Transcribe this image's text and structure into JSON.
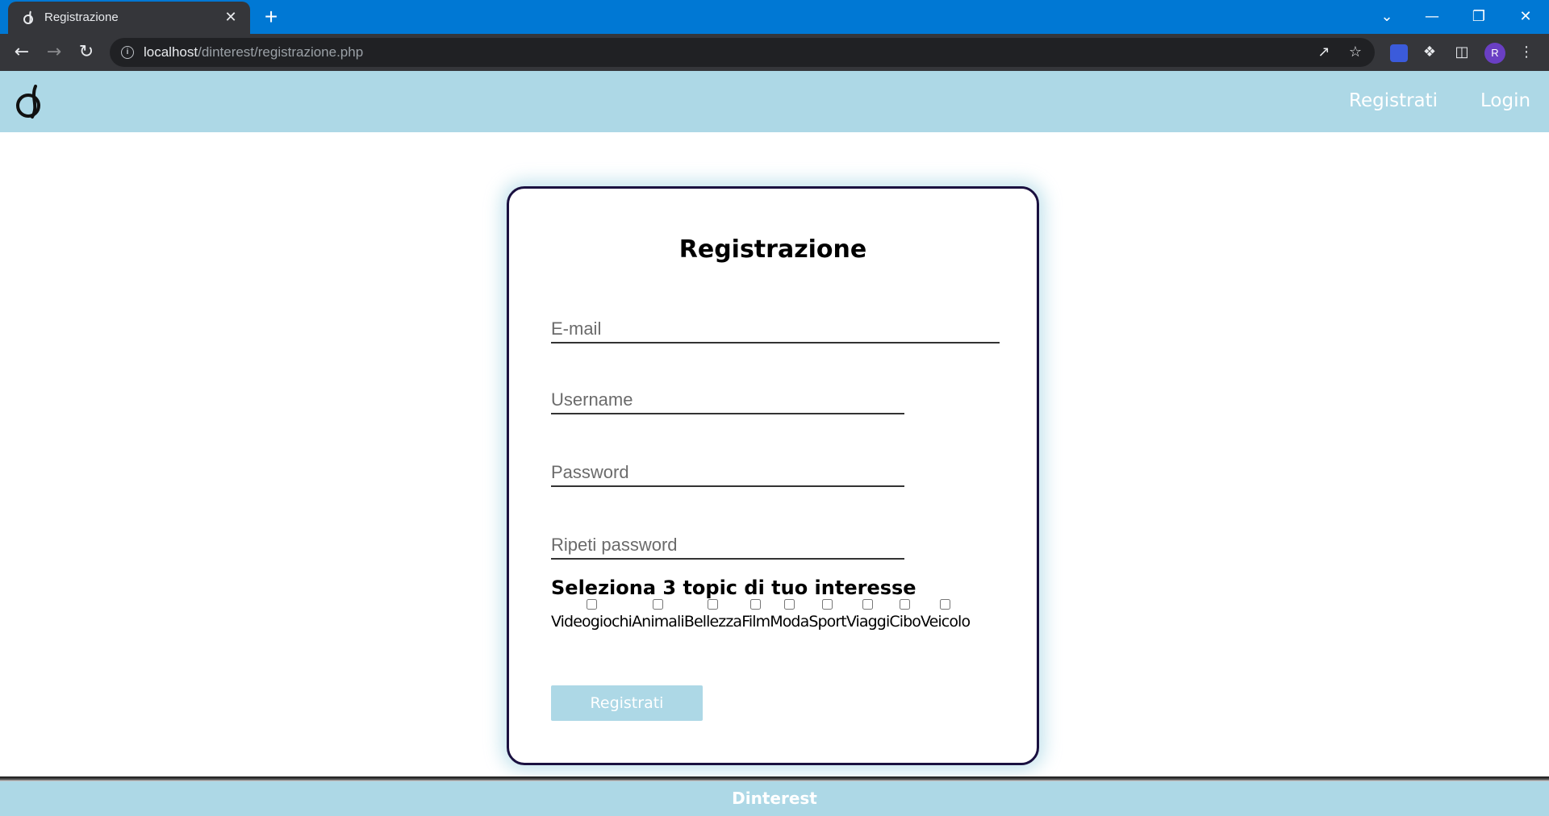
{
  "browser": {
    "tab_title": "Registrazione",
    "close_glyph": "✕",
    "new_tab_glyph": "+",
    "url_host": "localhost",
    "url_path": "/dinterest/registrazione.php",
    "profile_initial": "R",
    "window_controls": {
      "dropdown": "⌄",
      "minimize": "—",
      "restore": "❐",
      "close": "✕"
    }
  },
  "site": {
    "nav": {
      "register_label": "Registrati",
      "login_label": "Login"
    },
    "footer_text": "Dinterest",
    "colors": {
      "header_bg": "#add8e6",
      "card_border": "#1a1040"
    }
  },
  "form": {
    "title": "Registrazione",
    "email_placeholder": "E-mail",
    "username_placeholder": "Username",
    "password_placeholder": "Password",
    "repeat_password_placeholder": "Ripeti password",
    "topics_label": "Seleziona 3 topic di tuo interesse",
    "topics": [
      "Videogiochi",
      "Animali",
      "Bellezza",
      "Film",
      "Moda",
      "Sport",
      "Viaggi",
      "Cibo",
      "Veicolo"
    ],
    "submit_label": "Registrati"
  }
}
